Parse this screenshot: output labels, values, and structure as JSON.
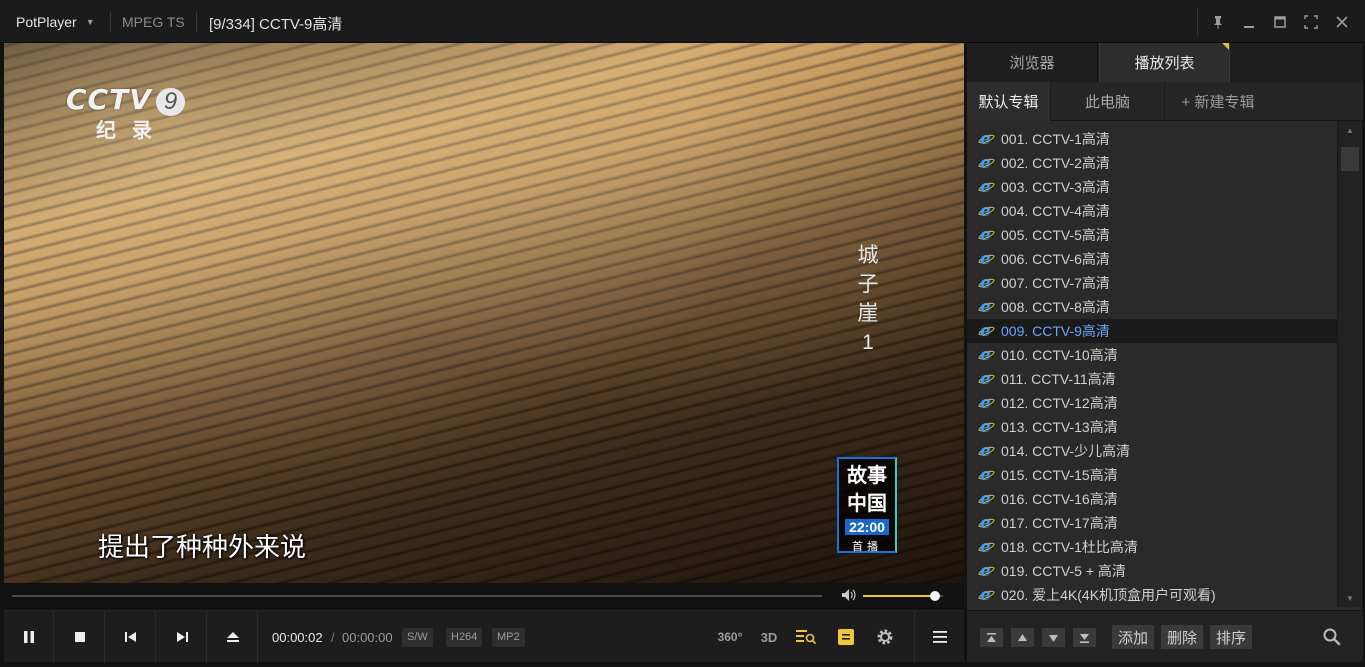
{
  "titlebar": {
    "app_name": "PotPlayer",
    "format": "MPEG TS",
    "title": "[9/334] CCTV-9高清"
  },
  "video": {
    "channel_logo": "CCTV",
    "channel_number": "9",
    "channel_sub": "纪录",
    "vertical_title": [
      "城",
      "子",
      "崖",
      "1"
    ],
    "promo_title_1": "故事",
    "promo_title_2": "中国",
    "promo_time": "22:00",
    "promo_sub": "首播",
    "subtitle": "提出了种种外来说"
  },
  "seek": {
    "progress": 0.0,
    "volume": 0.9
  },
  "controls": {
    "time_current": "00:00:02",
    "time_separator": "/",
    "time_total": "00:00:00",
    "tag_sw": "S/W",
    "tag_codec": "H264",
    "tag_audio": "MP2",
    "label_360": "360°",
    "label_3d": "3D"
  },
  "panel": {
    "tab_browser": "浏览器",
    "tab_playlist": "播放列表",
    "sub_default": "默认专辑",
    "sub_pc": "此电脑",
    "sub_new": "+ 新建专辑",
    "items": [
      "001. CCTV-1高清",
      "002. CCTV-2高清",
      "003. CCTV-3高清",
      "004. CCTV-4高清",
      "005. CCTV-5高清",
      "006. CCTV-6高清",
      "007. CCTV-7高清",
      "008. CCTV-8高清",
      "009. CCTV-9高清",
      "010. CCTV-10高清",
      "011. CCTV-11高清",
      "012. CCTV-12高清",
      "013. CCTV-13高清",
      "014. CCTV-少儿高清",
      "015. CCTV-15高清",
      "016. CCTV-16高清",
      "017. CCTV-17高清",
      "018. CCTV-1杜比高清",
      "019. CCTV-5 + 高清",
      "020. 爱上4K(4K机顶盒用户可观看)"
    ],
    "active_index": 8,
    "btn_add": "添加",
    "btn_delete": "删除",
    "btn_sort": "排序"
  },
  "colors": {
    "accent": "#f0c63a",
    "active_item": "#6aa8f5"
  }
}
